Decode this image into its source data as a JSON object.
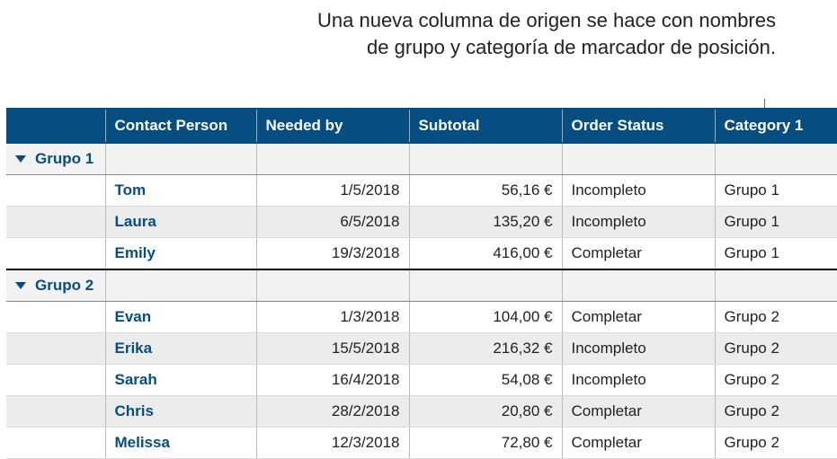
{
  "caption": "Una nueva columna de origen se hace con nombres de grupo y categoría de marcador de posición.",
  "columns": {
    "contact": "Contact Person",
    "needed": "Needed by",
    "subtotal": "Subtotal",
    "status": "Order Status",
    "category": "Category 1"
  },
  "groups": [
    {
      "name": "Grupo 1",
      "rows": [
        {
          "contact": "Tom",
          "needed": "1/5/2018",
          "subtotal": "56,16 €",
          "status": "Incompleto",
          "category": "Grupo 1"
        },
        {
          "contact": "Laura",
          "needed": "6/5/2018",
          "subtotal": "135,20 €",
          "status": "Incompleto",
          "category": "Grupo 1"
        },
        {
          "contact": "Emily",
          "needed": "19/3/2018",
          "subtotal": "416,00 €",
          "status": "Completar",
          "category": "Grupo 1"
        }
      ]
    },
    {
      "name": "Grupo 2",
      "rows": [
        {
          "contact": "Evan",
          "needed": "1/3/2018",
          "subtotal": "104,00 €",
          "status": "Completar",
          "category": "Grupo 2"
        },
        {
          "contact": "Erika",
          "needed": "15/5/2018",
          "subtotal": "216,32 €",
          "status": "Incompleto",
          "category": "Grupo 2"
        },
        {
          "contact": "Sarah",
          "needed": "16/4/2018",
          "subtotal": "54,08 €",
          "status": "Incompleto",
          "category": "Grupo 2"
        },
        {
          "contact": "Chris",
          "needed": "28/2/2018",
          "subtotal": "20,80 €",
          "status": "Completar",
          "category": "Grupo 2"
        },
        {
          "contact": "Melissa",
          "needed": "12/3/2018",
          "subtotal": "72,80 €",
          "status": "Completar",
          "category": "Grupo 2"
        }
      ]
    }
  ]
}
